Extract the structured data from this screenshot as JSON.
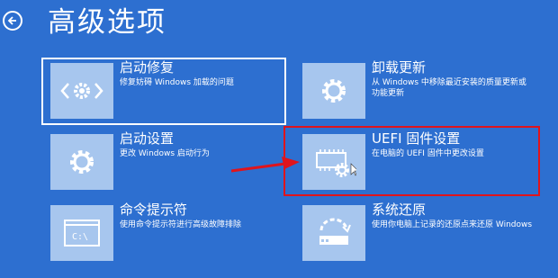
{
  "header": {
    "title": "高级选项"
  },
  "tiles": [
    {
      "title": "启动修复",
      "desc": "修复妨碍 Windows 加载的问题"
    },
    {
      "title": "卸载更新",
      "desc": "从 Windows 中移除最近安装的质量更新或功能更新"
    },
    {
      "title": "启动设置",
      "desc": "更改 Windows 启动行为"
    },
    {
      "title": "UEFI 固件设置",
      "desc": "在电脑的 UEFI 固件中更改设置"
    },
    {
      "title": "命令提示符",
      "desc": "使用命令提示符进行高级故障排除"
    },
    {
      "title": "系统还原",
      "desc": "使用你电脑上记录的还原点来还原 Windows"
    }
  ],
  "cmd_icon_text": "C:\\",
  "colors": {
    "background": "#2d6fd0",
    "tile_icon_bg": "#a7c6ee",
    "annotation_red": "#e0141c"
  }
}
